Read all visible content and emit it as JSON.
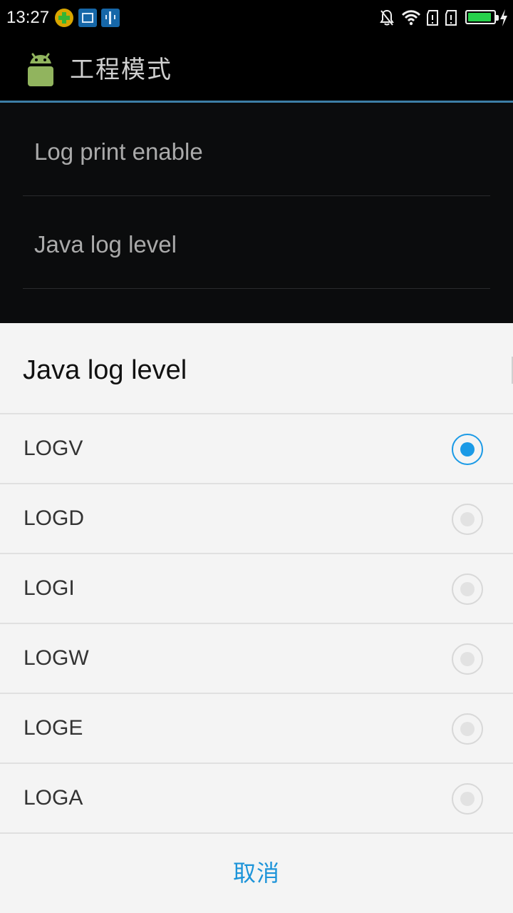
{
  "status_bar": {
    "time": "13:27",
    "left_icons": [
      "plus-app-icon",
      "screenshot-icon",
      "usb-icon"
    ],
    "right_icons": [
      "bell-off-icon",
      "wifi-icon",
      "sim1-icon",
      "sim2-icon",
      "battery-icon",
      "charging-icon"
    ],
    "battery_level": 0.9,
    "battery_color": "#27d14b"
  },
  "app_bar": {
    "title": "工程模式",
    "logo": "android-icon"
  },
  "preferences": [
    {
      "label": "Log print enable"
    },
    {
      "label": "Java log level"
    }
  ],
  "dialog": {
    "title": "Java log level",
    "options": [
      {
        "label": "LOGV",
        "selected": true
      },
      {
        "label": "LOGD",
        "selected": false
      },
      {
        "label": "LOGI",
        "selected": false
      },
      {
        "label": "LOGW",
        "selected": false
      },
      {
        "label": "LOGE",
        "selected": false
      },
      {
        "label": "LOGA",
        "selected": false
      }
    ],
    "cancel_label": "取消",
    "accent_color": "#1b9ae6"
  }
}
